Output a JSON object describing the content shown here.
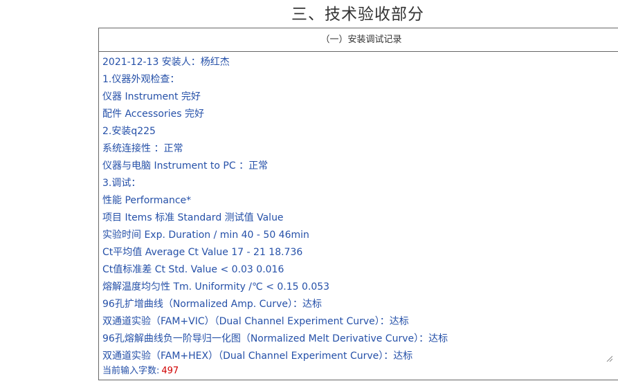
{
  "section_title": "三、技术验收部分",
  "panel": {
    "header": "（一）安装调试记录",
    "lines": [
      "2021-12-13 安装人：杨红杰",
      "1.仪器外观检查：",
      "仪器 Instrument 完好",
      "配件 Accessories 完好",
      "2.安装q225",
      "系统连接性 ：正常",
      "仪器与电脑 Instrument to PC ：正常",
      "3.调试：",
      "性能 Performance*",
      "项目 Items 标准 Standard 测试值 Value",
      "实验时间 Exp. Duration / min 40 - 50 46min",
      "Ct平均值 Average Ct Value 17 - 21 18.736",
      "Ct值标准差 Ct Std. Value < 0.03 0.016",
      "熔解温度均匀性 Tm. Uniformity /℃ < 0.15 0.053",
      "96孔扩增曲线（Normalized Amp. Curve）：达标",
      "双通道实验（FAM+VIC）（Dual Channel Experiment Curve）：达标",
      "96孔熔解曲线负一阶导归一化图（Normalized Melt Derivative Curve）：达标",
      "双通道实验（FAM+HEX）（Dual Channel Experiment Curve）：达标"
    ],
    "counter_label": "当前输入字数:",
    "counter_value": "497"
  },
  "colors": {
    "text_blue": "#2550a8",
    "counter_red": "#d00000",
    "border": "#666666",
    "title": "#333333"
  }
}
